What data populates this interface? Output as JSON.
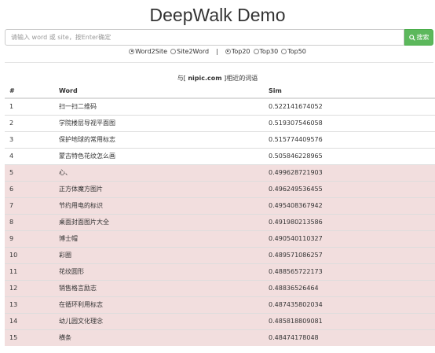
{
  "header": {
    "title": "DeepWalk Demo"
  },
  "search": {
    "placeholder": "请输入 word 或 site，按Enter确定",
    "value": "",
    "button_icon": "search-icon",
    "button_label": "搜索",
    "button_color": "#5cb85c"
  },
  "options": {
    "mode": [
      {
        "label": "Word2Site",
        "selected": true
      },
      {
        "label": "Site2Word",
        "selected": false
      }
    ],
    "separator": "|",
    "topn": [
      {
        "label": "Top20",
        "selected": true
      },
      {
        "label": "Top30",
        "selected": false
      },
      {
        "label": "Top50",
        "selected": false
      }
    ]
  },
  "caption": {
    "prefix": "与[",
    "term": "nipic.com",
    "suffix": "]相近的词语"
  },
  "table": {
    "headers": [
      "#",
      "Word",
      "Sim"
    ],
    "highlight_color": "#f2dede",
    "rows": [
      {
        "n": "1",
        "word": "扫一扫二维码",
        "sim": "0.522141674052",
        "highlight": false
      },
      {
        "n": "2",
        "word": "学院楼层导视平面图",
        "sim": "0.519307546058",
        "highlight": false
      },
      {
        "n": "3",
        "word": "保护地球的常用标志",
        "sim": "0.515774409576",
        "highlight": false
      },
      {
        "n": "4",
        "word": "蒙古特色花纹怎么画",
        "sim": "0.505846228965",
        "highlight": false
      },
      {
        "n": "5",
        "word": "心、",
        "sim": "0.499628721903",
        "highlight": true
      },
      {
        "n": "6",
        "word": "正方体魔方图片",
        "sim": "0.496249536455",
        "highlight": true
      },
      {
        "n": "7",
        "word": "节约用电的标识",
        "sim": "0.495408367942",
        "highlight": true
      },
      {
        "n": "8",
        "word": "桌面封面图片大全",
        "sim": "0.491980213586",
        "highlight": true
      },
      {
        "n": "9",
        "word": "博士帽",
        "sim": "0.490540110327",
        "highlight": true
      },
      {
        "n": "10",
        "word": "彩圈",
        "sim": "0.489571086257",
        "highlight": true
      },
      {
        "n": "11",
        "word": "花纹圆形",
        "sim": "0.488565722173",
        "highlight": true
      },
      {
        "n": "12",
        "word": "销售格言励志",
        "sim": "0.48836526464",
        "highlight": true
      },
      {
        "n": "13",
        "word": "在循环利用标志",
        "sim": "0.487435802034",
        "highlight": true
      },
      {
        "n": "14",
        "word": "幼儿园文化理念",
        "sim": "0.485818809081",
        "highlight": true
      },
      {
        "n": "15",
        "word": "横条",
        "sim": "0.48474178048",
        "highlight": true
      }
    ]
  }
}
